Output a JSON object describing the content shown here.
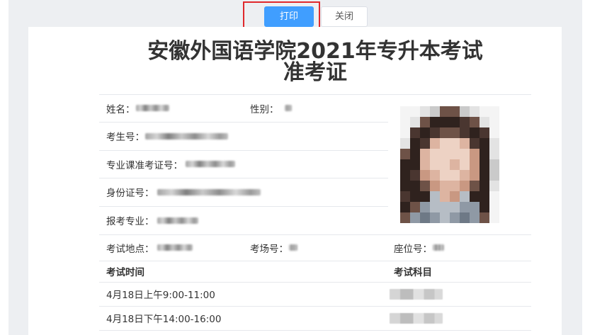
{
  "toolbar": {
    "print_label": "打印",
    "close_label": "关闭"
  },
  "ticket": {
    "title_line1": "安徽外国语学院2021年专升本考试",
    "title_line2": "准考证",
    "fields": {
      "name": "姓名：",
      "gender": "性别：",
      "candidate_no": "考生号：",
      "major_ticket_no": "专业课准考证号：",
      "id_card_no": "身份证号：",
      "major": "报考专业：",
      "venue": "考试地点：",
      "room_no": "考场号：",
      "seat_no": "座位号："
    },
    "schedule": {
      "time_header": "考试时间",
      "subject_header": "考试科目",
      "rows": [
        {
          "time": "4月18日上午9:00-11:00"
        },
        {
          "time": "4月18日下午14:00-16:00"
        }
      ]
    }
  },
  "colors": {
    "primary_button": "#409eff",
    "highlight_border": "#e0282c"
  }
}
